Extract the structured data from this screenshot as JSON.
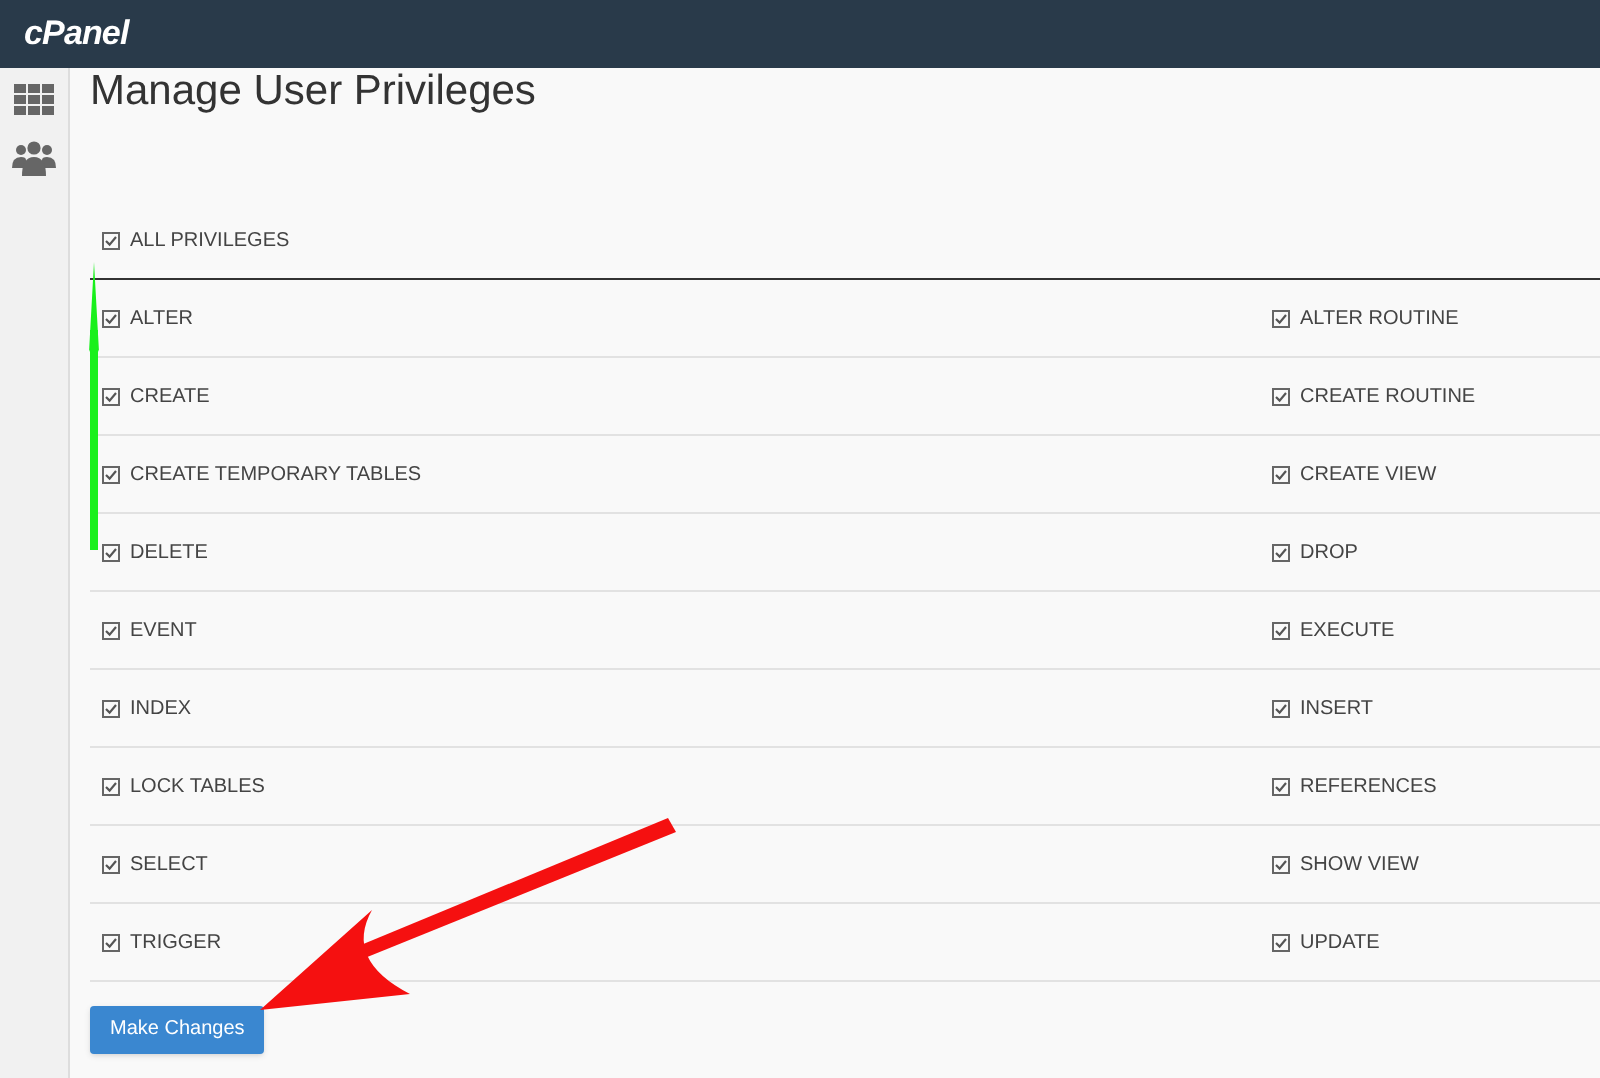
{
  "header": {
    "logo": "cPanel"
  },
  "page": {
    "title": "Manage User Privileges"
  },
  "all_privileges": {
    "label": "ALL PRIVILEGES",
    "checked": true
  },
  "privileges": [
    {
      "label": "ALTER",
      "checked": true
    },
    {
      "label": "ALTER ROUTINE",
      "checked": true
    },
    {
      "label": "CREATE",
      "checked": true
    },
    {
      "label": "CREATE ROUTINE",
      "checked": true
    },
    {
      "label": "CREATE TEMPORARY TABLES",
      "checked": true
    },
    {
      "label": "CREATE VIEW",
      "checked": true
    },
    {
      "label": "DELETE",
      "checked": true
    },
    {
      "label": "DROP",
      "checked": true
    },
    {
      "label": "EVENT",
      "checked": true
    },
    {
      "label": "EXECUTE",
      "checked": true
    },
    {
      "label": "INDEX",
      "checked": true
    },
    {
      "label": "INSERT",
      "checked": true
    },
    {
      "label": "LOCK TABLES",
      "checked": true
    },
    {
      "label": "REFERENCES",
      "checked": true
    },
    {
      "label": "SELECT",
      "checked": true
    },
    {
      "label": "SHOW VIEW",
      "checked": true
    },
    {
      "label": "TRIGGER",
      "checked": true
    },
    {
      "label": "UPDATE",
      "checked": true
    }
  ],
  "submit": {
    "label": "Make Changes"
  }
}
